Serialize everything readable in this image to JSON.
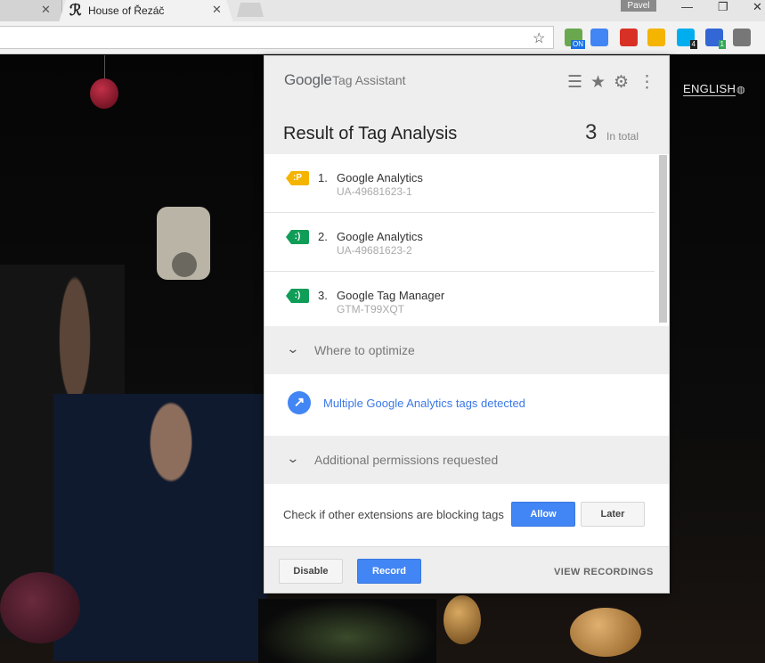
{
  "browser": {
    "tab_prev_close": "✕",
    "active_tab": {
      "favicon": "ℛ",
      "title": "House of Řezáč",
      "close": "✕"
    },
    "profile_name": "Pavel",
    "window_buttons": [
      "—",
      "❐",
      "✕"
    ],
    "extensions": [
      {
        "name": "eye-extension-icon",
        "color": "#6aa84f",
        "badge": "ON",
        "badge_color": "#1a73e8"
      },
      {
        "name": "translate-extension-icon",
        "color": "#4285f4",
        "badge": "",
        "badge_color": ""
      },
      {
        "name": "flag-extension-icon",
        "color": "#d93025",
        "badge": "",
        "badge_color": ""
      },
      {
        "name": "tag-assistant-extension-icon",
        "color": "#f4b400",
        "badge": "",
        "badge_color": ""
      },
      {
        "name": "ghostery-extension-icon",
        "color": "#00aef0",
        "badge": "4",
        "badge_color": "#222"
      },
      {
        "name": "code-extension-icon",
        "color": "#3367d6",
        "badge": "1",
        "badge_color": "#34a853"
      },
      {
        "name": "puzzle-extension-icon",
        "color": "#777777",
        "badge": "",
        "badge_color": ""
      }
    ]
  },
  "page": {
    "language_link": "ENGLISH",
    "globe": "◍"
  },
  "popup": {
    "brand": "Google",
    "product": "Tag Assistant",
    "header_icons": {
      "filter": "☰",
      "star": "★",
      "gear": "⚙",
      "more": "⋮"
    },
    "result_title": "Result of Tag Analysis",
    "total_count": "3",
    "total_label": "In total",
    "tags": [
      {
        "num": "1.",
        "name": "Google Analytics",
        "id": "UA-49681623-1",
        "badge": ":P",
        "color": "#f4b400"
      },
      {
        "num": "2.",
        "name": "Google Analytics",
        "id": "UA-49681623-2",
        "badge": ":)",
        "color": "#0f9d58"
      },
      {
        "num": "3.",
        "name": "Google Tag Manager",
        "id": "GTM-T99XQT",
        "badge": ":)",
        "color": "#0f9d58"
      }
    ],
    "optimize_section": {
      "chevron": "⌄",
      "label": "Where to optimize"
    },
    "optimize_item": {
      "icon": "↗",
      "text": "Multiple Google Analytics tags detected"
    },
    "permissions_section": {
      "chevron": "⌄",
      "label": "Additional permissions requested"
    },
    "permissions_item": {
      "text": "Check if other extensions are blocking tags",
      "allow": "Allow",
      "later": "Later"
    },
    "footer": {
      "disable": "Disable",
      "record": "Record",
      "view_recordings": "VIEW RECORDINGS"
    }
  }
}
